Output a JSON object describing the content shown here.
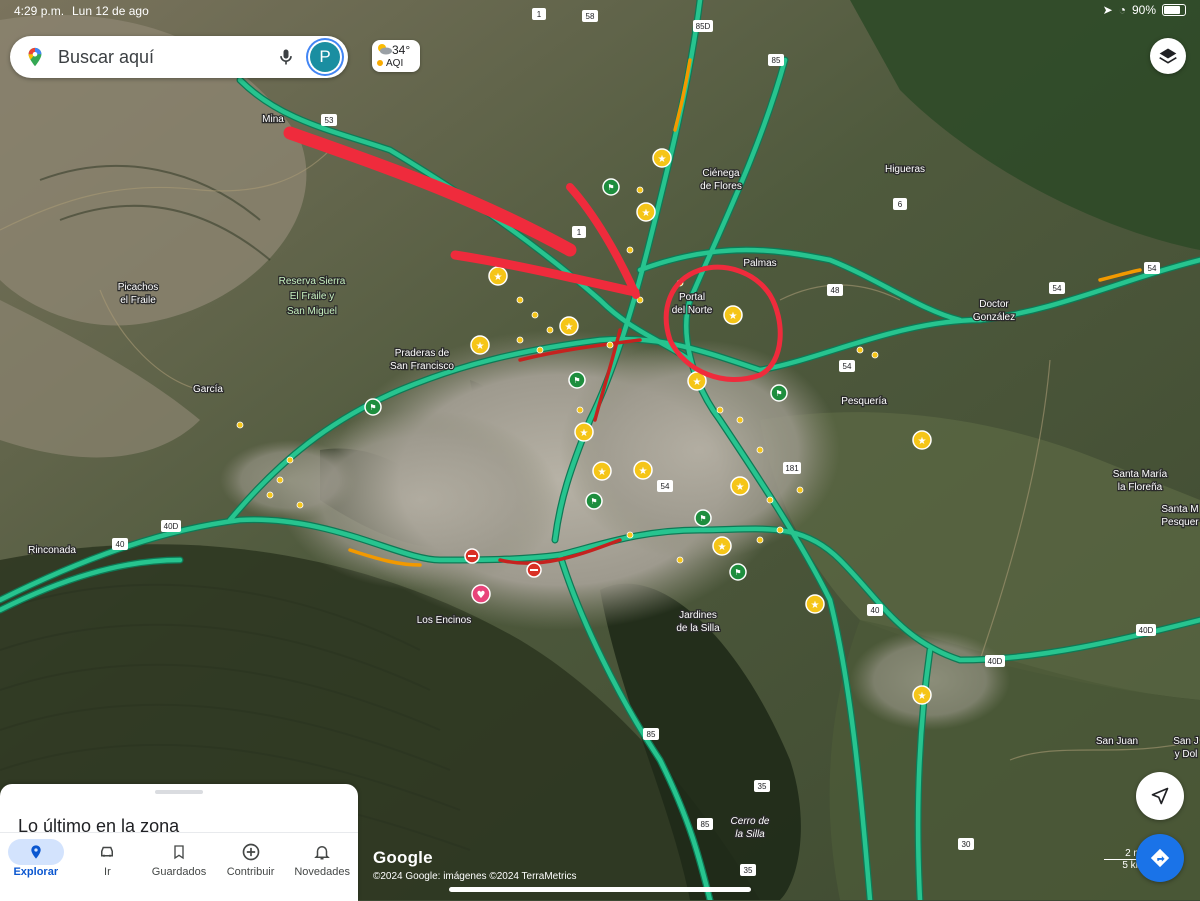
{
  "status_bar": {
    "time": "4:29 p.m.",
    "date": "Lun 12 de ago",
    "battery": "90%",
    "battery_level": 0.9
  },
  "search": {
    "placeholder": "Buscar aquí",
    "avatar_letter": "P"
  },
  "weather": {
    "temperature": "34°",
    "aqi_label": "AQI"
  },
  "colors": {
    "road": "#27c48f",
    "road_border": "#0e7a56",
    "traffic_red": "#c5221f",
    "traffic_orange": "#f29900",
    "poi_yellow": "#f5c518",
    "annotation_red": "#ef2b3c",
    "accent_blue": "#1a73e8"
  },
  "map_labels": {
    "mina": "Mina",
    "picachos": "Picachos\nel Fraile",
    "reserva": "Reserva Sierra\nEl Fraile y\nSan Miguel",
    "praderas": "Praderas de\nSan Francisco",
    "garcia": "García",
    "rinconada": "Rinconada",
    "los_encinos": "Los Encinos",
    "cienega": "Ciénega\nde Flores",
    "higueras": "Higueras",
    "portal": "Portal\ndel Norte",
    "palmas": "Palmas",
    "doctor_gonzalez": "Doctor\nGonzález",
    "pesqueria": "Pesquería",
    "santa_maria": "Santa María\nla Floreña",
    "santa_maria_pesq": "Santa M\nPesquer",
    "jardines": "Jardines\nde la Silla",
    "cerro": "Cerro de\nla Silla",
    "san_juan": "San Juan",
    "san_dolores": "San J\ny Dol"
  },
  "route_shields": {
    "r1": "1",
    "r58": "58",
    "r85d": "85D",
    "r85a": "85",
    "r53": "53",
    "r1b": "1",
    "r6": "6",
    "r48": "48",
    "r54a": "54",
    "r54b": "54",
    "r54c": "54",
    "r54d": "54",
    "r181": "181",
    "r40d": "40D",
    "r40": "40",
    "r40b": "40",
    "r40d2": "40D",
    "r40d3": "40D",
    "r85b": "85",
    "r85c": "85",
    "r35a": "35",
    "r35b": "35",
    "r30": "30"
  },
  "bottom_panel": {
    "title": "Lo último en la zona"
  },
  "tabs": [
    {
      "label": "Explorar",
      "icon": "location-pin-icon",
      "active": true
    },
    {
      "label": "Ir",
      "icon": "car-icon",
      "active": false
    },
    {
      "label": "Guardados",
      "icon": "bookmark-icon",
      "active": false
    },
    {
      "label": "Contribuir",
      "icon": "add-circle-icon",
      "active": false
    },
    {
      "label": "Novedades",
      "icon": "bell-icon",
      "active": false
    }
  ],
  "attribution": {
    "logo": "Google",
    "copyright": "©2024 Google: imágenes ©2024 TerraMetrics",
    "scale_a": "2 mi",
    "scale_b": "5 km"
  }
}
